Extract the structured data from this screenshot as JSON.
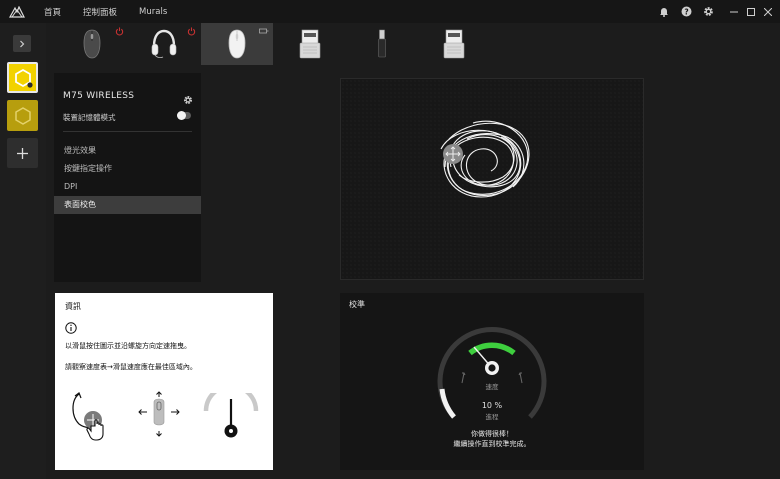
{
  "topbar": {
    "nav": [
      "首頁",
      "控制面板",
      "Murals"
    ]
  },
  "devices": [
    {
      "name": "mouse-dark",
      "icon": "dark-mouse-icon",
      "power_off": true
    },
    {
      "name": "headset",
      "icon": "headset-icon",
      "power_off": true
    },
    {
      "name": "m75-wireless",
      "icon": "white-mouse-icon",
      "active": true
    },
    {
      "name": "usb-receiver-1",
      "icon": "usb-receiver-icon"
    },
    {
      "name": "usb-dongle",
      "icon": "usb-dongle-icon"
    },
    {
      "name": "usb-receiver-2",
      "icon": "usb-receiver-icon"
    }
  ],
  "settings": {
    "device_title": "M75 WIRELESS",
    "memory_mode_label": "裝置記憶體模式",
    "memory_mode_on": true,
    "menu": [
      {
        "label": "燈光效果",
        "active": false
      },
      {
        "label": "按鍵指定操作",
        "active": false
      },
      {
        "label": "DPI",
        "active": false
      },
      {
        "label": "表面校色",
        "active": true
      }
    ]
  },
  "info": {
    "title": "資訊",
    "line1": "以滑鼠按住圖示並沿螺旋方向定速拖曳。",
    "line2": "請觀察速度表→滑鼠速度應在最佳區域內。"
  },
  "calibration": {
    "title": "校準",
    "speed_label": "速度",
    "progress_percent": "10 %",
    "progress_value": 10,
    "progress_label": "進程",
    "message_line1": "你做得很棒！",
    "message_line2": "繼續操作直到校準完成。"
  },
  "colors": {
    "accent_yellow": "#f2d200",
    "gauge_green": "#3ecf3e",
    "panel_dark": "#151515"
  }
}
